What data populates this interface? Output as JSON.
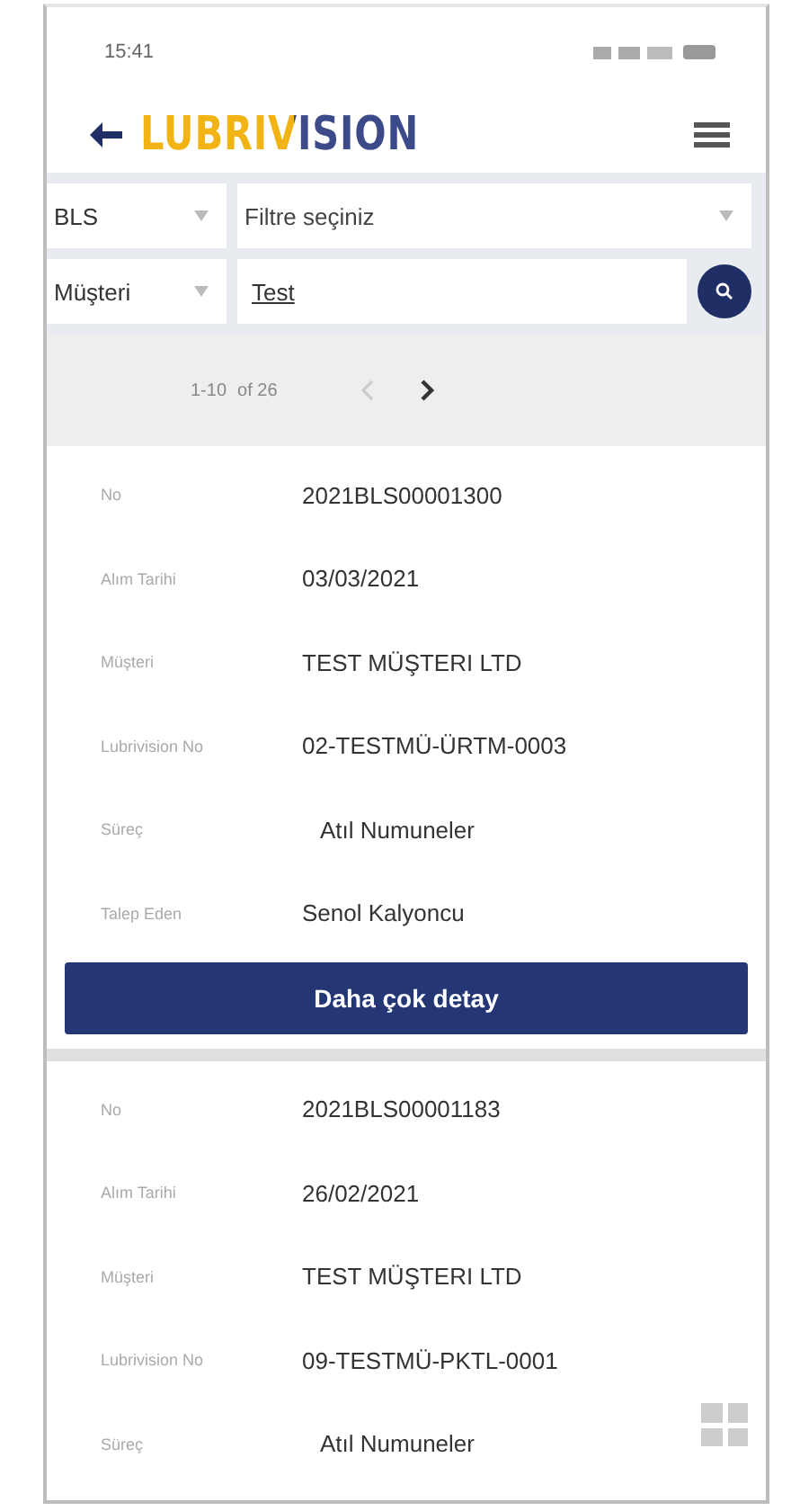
{
  "status_bar": {
    "time": "15:41"
  },
  "header": {
    "logo": "LUBRIVISION"
  },
  "filters": [
    [
      {
        "kind": "select",
        "value": "BLS"
      },
      {
        "kind": "select",
        "placeholder": "Filtre seçiniz"
      }
    ],
    [
      {
        "kind": "select",
        "value": "Müşteri"
      },
      {
        "kind": "input",
        "value": "Test"
      },
      {
        "kind": "search"
      }
    ]
  ],
  "pagination": {
    "range": "1-10",
    "total": "of 26",
    "prev_disabled": true,
    "next_disabled": false
  },
  "records": [
    {
      "fields": [
        {
          "label": "No",
          "value": "2021BLS00001300"
        },
        {
          "label": "Alım Tarihi",
          "value": "03/03/2021"
        },
        {
          "label": "Müşteri",
          "value": "TEST MÜŞTERI LTD"
        },
        {
          "label": "Lubrivision No",
          "value": "02-TESTMÜ-ÜRTM-0003"
        },
        {
          "label": "Süreç",
          "value": "Atıl Numuneler"
        },
        {
          "label": "Talep Eden",
          "value": "Senol Kalyoncu"
        }
      ],
      "button": "Daha çok detay"
    },
    {
      "fields": [
        {
          "label": "No",
          "value": "2021BLS00001183"
        },
        {
          "label": "Alım Tarihi",
          "value": "26/02/2021"
        },
        {
          "label": "Müşteri",
          "value": "TEST MÜŞTERI LTD"
        },
        {
          "label": "Lubrivision No",
          "value": "09-TESTMÜ-PKTL-0001"
        },
        {
          "label": "Süreç",
          "value": "Atıl Numuneler"
        }
      ]
    }
  ]
}
